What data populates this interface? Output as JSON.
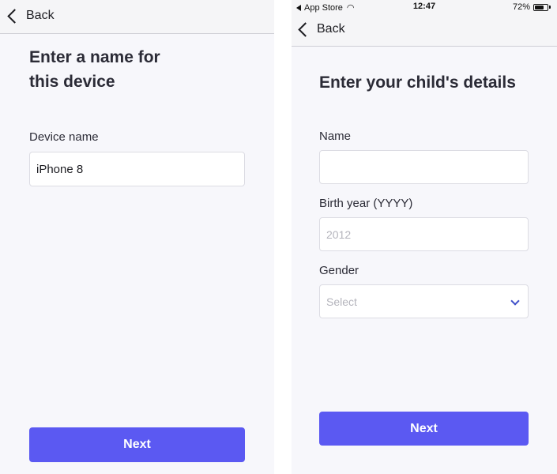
{
  "left_screen": {
    "nav": {
      "back_label": "Back"
    },
    "title_line1": "Enter a name for",
    "title_line2": "this device",
    "device_name": {
      "label": "Device name",
      "value": "iPhone 8"
    },
    "next_label": "Next"
  },
  "right_screen": {
    "status_bar": {
      "carrier": "App Store",
      "time": "12:47",
      "battery_percent": "72%",
      "battery_level": 0.72
    },
    "nav": {
      "back_label": "Back"
    },
    "title": "Enter your child's details",
    "name_field": {
      "label": "Name",
      "value": ""
    },
    "birth_year_field": {
      "label": "Birth year (YYYY)",
      "placeholder": "2012"
    },
    "gender_field": {
      "label": "Gender",
      "placeholder": "Select"
    },
    "next_label": "Next"
  },
  "colors": {
    "accent": "#5b59f2",
    "select_chevron": "#3f4fc9",
    "top_accent": "#c9434b",
    "background": "#f7f7fb"
  },
  "icons": [
    "back-chevron-icon",
    "wifi-icon",
    "battery-icon",
    "dropdown-chevron-icon"
  ]
}
